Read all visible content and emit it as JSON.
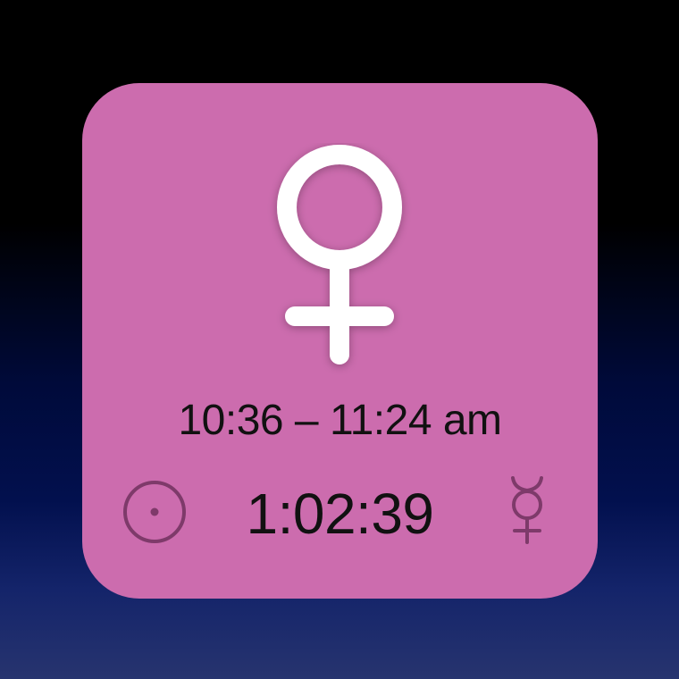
{
  "widget": {
    "current_planet": {
      "icon": "venus-icon",
      "color": "#ffffff"
    },
    "time_range": "10:36 – 11:24 am",
    "countdown": "1:02:39",
    "previous_planet": {
      "icon": "sun-icon",
      "color": "#7e3a6a"
    },
    "next_planet": {
      "icon": "mercury-icon",
      "color": "#7e3a6a"
    },
    "background_color": "#cc6cae"
  }
}
